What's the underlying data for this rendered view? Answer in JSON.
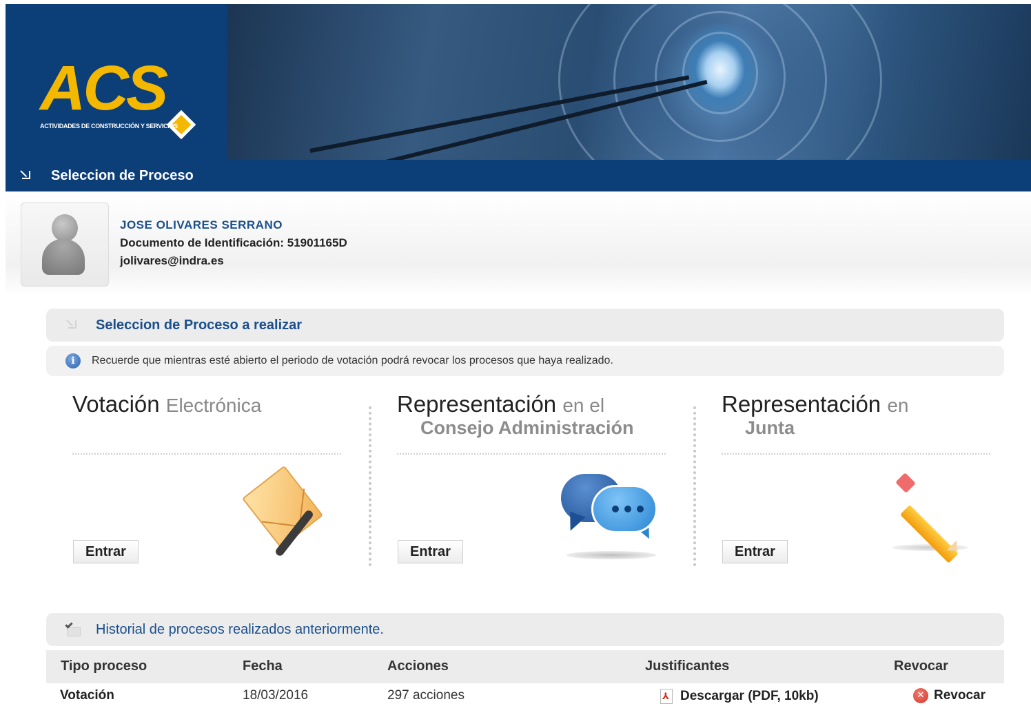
{
  "brand": {
    "logo_text": "ACS",
    "logo_subtitle": "ACTIVIDADES DE CONSTRUCCIÓN Y SERVICIOS"
  },
  "page": {
    "title": "Seleccion de Proceso"
  },
  "user": {
    "name": "JOSE OLIVARES SERRANO",
    "document_line": "Documento de Identificación: 51901165D",
    "email": "jolivares@indra.es"
  },
  "selection": {
    "header": "Seleccion de Proceso a realizar",
    "notice": "Recuerde que mientras esté abierto el periodo de votación podrá revocar los procesos que haya realizado.",
    "info_icon_glyph": "i",
    "cards": [
      {
        "title_main": "Votación",
        "title_rest": "Electrónica",
        "title_line2": "",
        "button_label": "Entrar",
        "icon": "envelope-icon"
      },
      {
        "title_main": "Representación",
        "title_rest": "en el",
        "title_line2": "Consejo Administración",
        "button_label": "Entrar",
        "icon": "chat-bubbles-icon"
      },
      {
        "title_main": "Representación",
        "title_rest": "en",
        "title_line2": "Junta",
        "button_label": "Entrar",
        "icon": "pencil-icon"
      }
    ]
  },
  "history": {
    "header": "Historial de procesos realizados anteriormente.",
    "columns": [
      "Tipo proceso",
      "Fecha",
      "Acciones",
      "Justificantes",
      "Revocar"
    ],
    "rows": [
      {
        "tipo": "Votación",
        "fecha": "18/03/2016",
        "acciones": "297 acciones",
        "justificante": "Descargar (PDF, 10kb)",
        "revocar": "Revocar"
      }
    ]
  },
  "colors": {
    "brand_blue": "#0c3e78",
    "brand_yellow": "#f5b800",
    "link_blue": "#1b4f8c"
  }
}
